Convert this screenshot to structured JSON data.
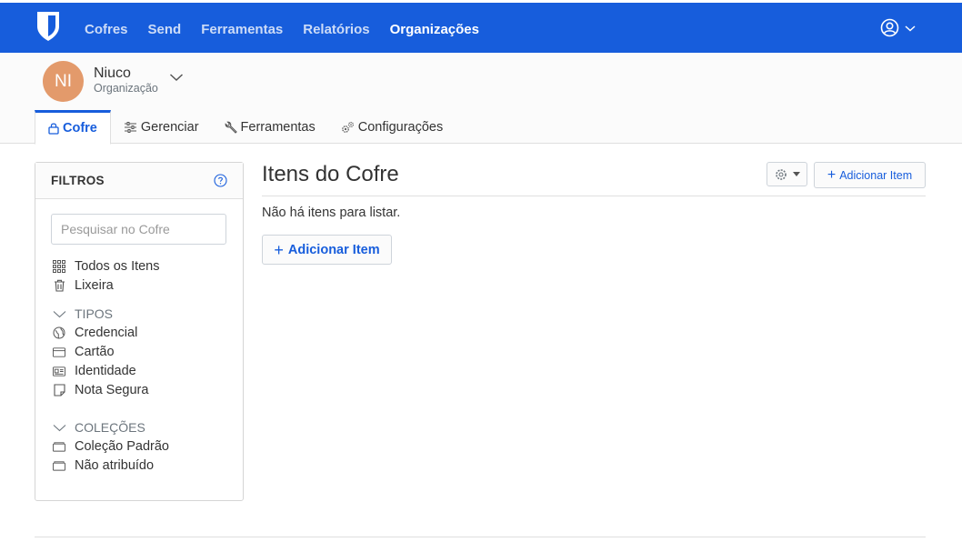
{
  "navbar": {
    "links": [
      "Cofres",
      "Send",
      "Ferramentas",
      "Relatórios",
      "Organizações"
    ],
    "active": "Organizações",
    "brand_color": "#175ddc"
  },
  "org": {
    "initials": "NI",
    "name": "Niuco",
    "type": "Organização",
    "avatar_color": "#e39a6b"
  },
  "tabs": [
    {
      "label": "Cofre",
      "icon": "lock-icon"
    },
    {
      "label": "Gerenciar",
      "icon": "sliders-icon"
    },
    {
      "label": "Ferramentas",
      "icon": "wrench-icon"
    },
    {
      "label": "Configurações",
      "icon": "cogs-icon"
    }
  ],
  "filters": {
    "title": "FILTROS",
    "search_placeholder": "Pesquisar no Cofre",
    "all_items": "Todos os Itens",
    "trash": "Lixeira",
    "types_heading": "TIPOS",
    "types": [
      "Credencial",
      "Cartão",
      "Identidade",
      "Nota Segura"
    ],
    "collections_heading": "COLEÇÕES",
    "collections": [
      "Coleção Padrão",
      "Não atribuído"
    ]
  },
  "main": {
    "title": "Itens do Cofre",
    "add_item_label": "Adicionar Item",
    "empty_message": "Não há itens para listar.",
    "add_item_button": "Adicionar Item"
  }
}
